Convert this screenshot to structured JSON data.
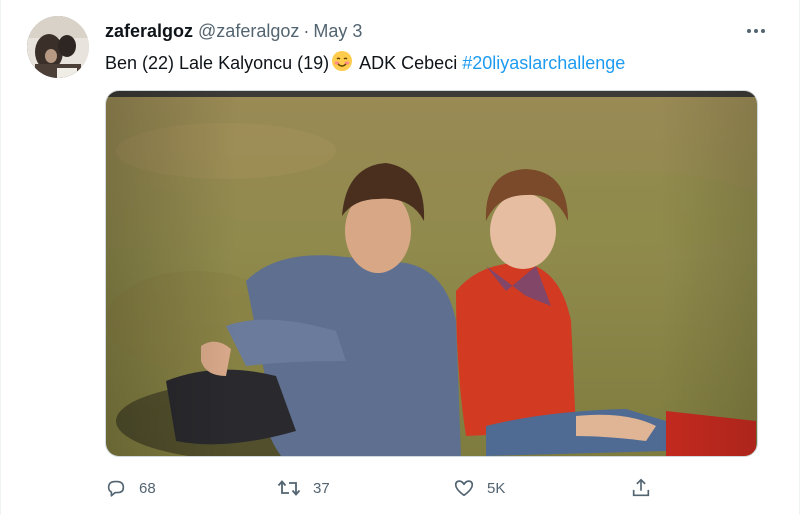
{
  "tweet": {
    "display_name": "zaferalgoz",
    "handle": "@zaferalgoz",
    "separator": "·",
    "date": "May 3",
    "text_main": "Ben (22) Lale Kalyoncu (19)",
    "emoji": "smiling-face-icon",
    "text_after": " ADK Cebeci ",
    "hashtag": "#20liyaslarchallenge",
    "media_alt": "Photo of two young people sitting back to back on grass"
  },
  "actions": {
    "reply_count": "68",
    "retweet_count": "37",
    "like_count": "5K"
  },
  "colors": {
    "text": "#0f1419",
    "secondary": "#536471",
    "link": "#1d9bf0",
    "border": "#cfd9de"
  }
}
